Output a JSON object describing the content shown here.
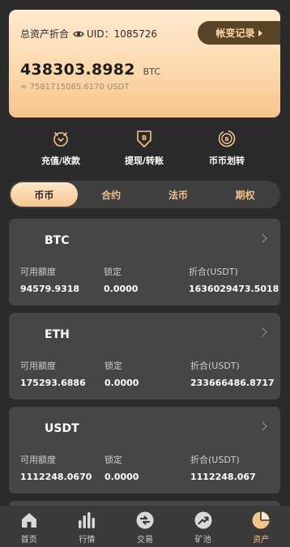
{
  "asset": {
    "title": "总资产折合",
    "uid": "UID：1085726",
    "record_label": "帐变记录",
    "amount": "438303.8982",
    "unit": "BTC",
    "sub_amount": "≈ 7581715085.6170 USDT"
  },
  "actions": [
    {
      "label": "充值/收款",
      "icon": "recharge-icon"
    },
    {
      "label": "提现/转账",
      "icon": "withdraw-icon"
    },
    {
      "label": "币币划转",
      "icon": "transfer-icon"
    }
  ],
  "tabs": [
    "币币",
    "合约",
    "法币",
    "期权"
  ],
  "active_tab": "币币",
  "coins": [
    {
      "name": "BTC",
      "available_label": "可用额度",
      "available": "94579.9318",
      "locked_label": "锁定",
      "locked": "0.0000",
      "value_label": "折合(USDT)",
      "value": "1636029473.5018"
    },
    {
      "name": "ETH",
      "available_label": "可用额度",
      "available": "175293.6886",
      "locked_label": "锁定",
      "locked": "0.0000",
      "value_label": "折合(USDT)",
      "value": "233666486.8717"
    },
    {
      "name": "USDT",
      "available_label": "可用额度",
      "available": "1112248.0670",
      "locked_label": "锁定",
      "locked": "0.0000",
      "value_label": "折合(USDT)",
      "value": "1112248.067"
    }
  ],
  "tabbar": [
    {
      "label": "首页",
      "icon": "home-icon"
    },
    {
      "label": "行情",
      "icon": "market-icon"
    },
    {
      "label": "交易",
      "icon": "trade-icon"
    },
    {
      "label": "矿池",
      "icon": "mining-icon"
    },
    {
      "label": "资产",
      "icon": "assets-icon"
    }
  ],
  "colors": {
    "accent": "#f6c38a",
    "background": "#2b2b2b",
    "card": "#464646"
  }
}
